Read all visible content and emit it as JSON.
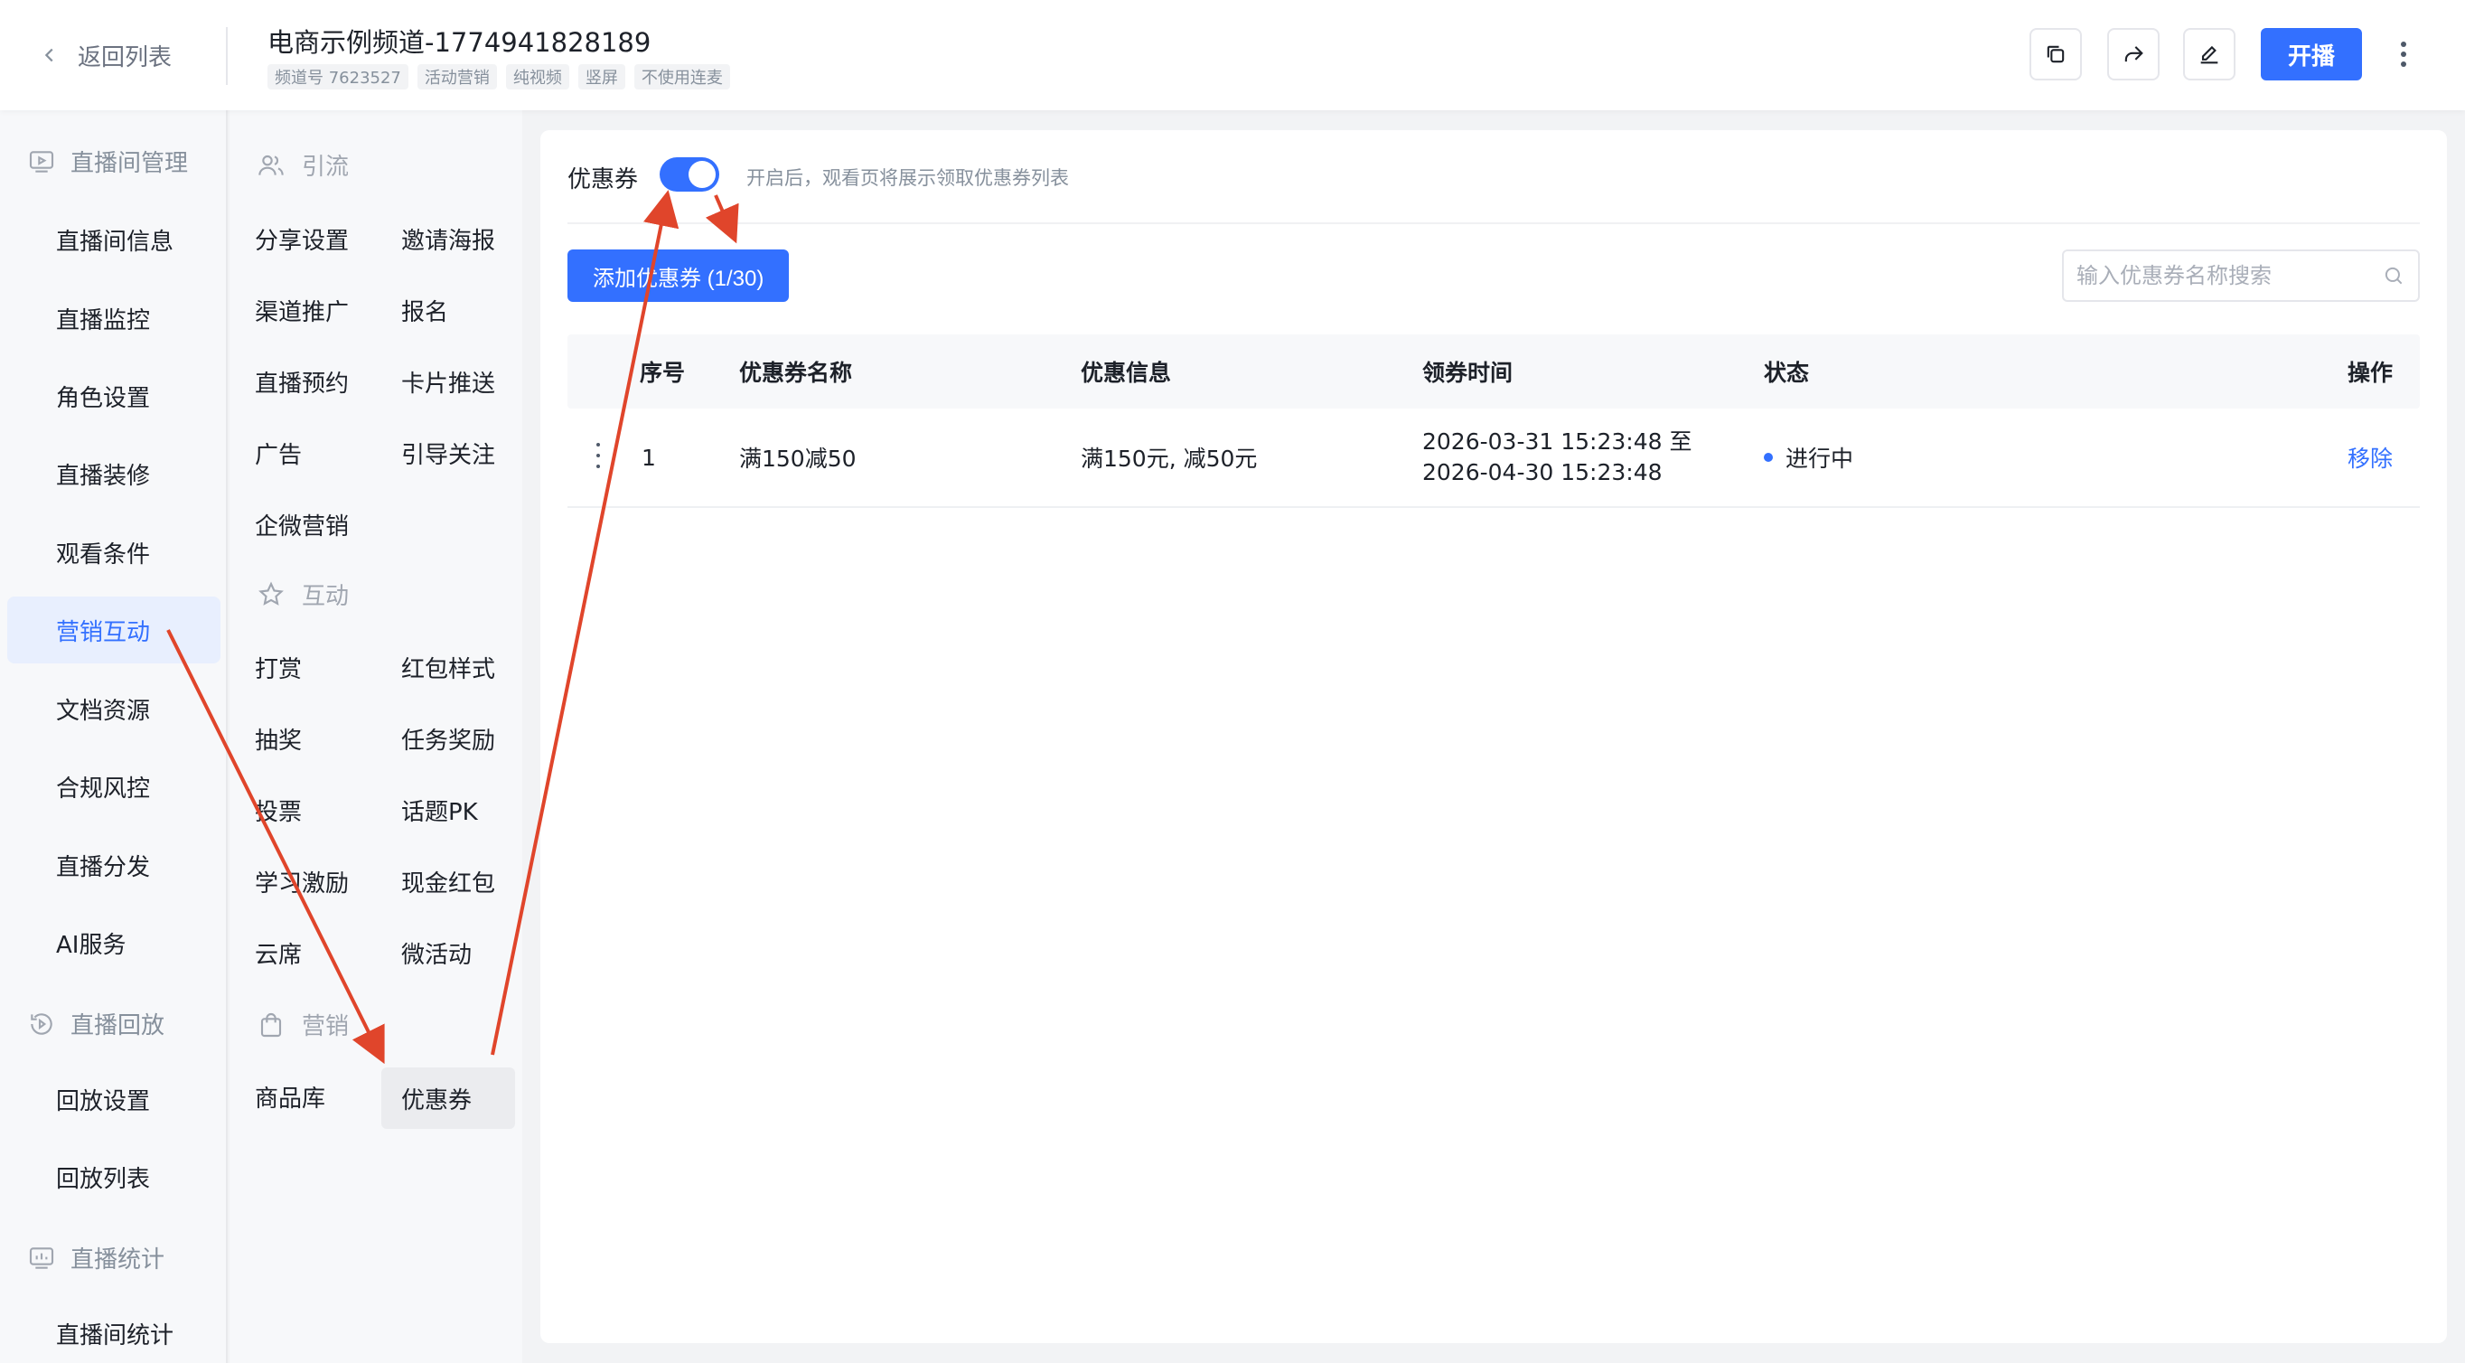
{
  "header": {
    "back_label": "返回列表",
    "title": "电商示例频道-1774941828189",
    "tags": [
      "频道号 7623527",
      "活动营销",
      "纯视频",
      "竖屏",
      "不使用连麦"
    ],
    "start_label": "开播"
  },
  "leftnav": {
    "groups": [
      {
        "label": "直播间管理",
        "icon": "live-room-icon"
      },
      {
        "label": "直播回放",
        "icon": "replay-icon"
      },
      {
        "label": "直播统计",
        "icon": "stats-icon"
      }
    ],
    "items": [
      "直播间信息",
      "直播监控",
      "角色设置",
      "直播装修",
      "观看条件",
      "营销互动",
      "文档资源",
      "合规风控",
      "直播分发",
      "AI服务",
      "回放设置",
      "回放列表",
      "直播间统计"
    ],
    "active": "营销互动"
  },
  "submenu": {
    "groups": [
      {
        "label": "引流",
        "icon": "users-icon"
      },
      {
        "label": "互动",
        "icon": "star-icon"
      },
      {
        "label": "营销",
        "icon": "bag-icon"
      }
    ],
    "items": [
      "分享设置",
      "邀请海报",
      "渠道推广",
      "报名",
      "直播预约",
      "卡片推送",
      "广告",
      "引导关注",
      "企微营销",
      "打赏",
      "红包样式",
      "抽奖",
      "任务奖励",
      "投票",
      "话题PK",
      "学习激励",
      "现金红包",
      "云席",
      "微活动",
      "商品库",
      "优惠券"
    ],
    "active": "优惠券"
  },
  "main": {
    "coupon_label": "优惠券",
    "switch_on": true,
    "switch_hint": "开启后，观看页将展示领取优惠券列表",
    "add_button": "添加优惠券 (1/30)",
    "search_placeholder": "输入优惠券名称搜索",
    "table": {
      "columns": [
        "序号",
        "优惠券名称",
        "优惠信息",
        "领券时间",
        "状态",
        "操作"
      ],
      "rows": [
        {
          "index": "1",
          "name": "满150减50",
          "info": "满150元, 减50元",
          "time_start": "2026-03-31 15:23:48 至",
          "time_end": "2026-04-30 15:23:48",
          "status": "进行中",
          "action": "移除"
        }
      ]
    }
  },
  "colors": {
    "accent": "#3370ff",
    "annotation": "#e0452b"
  }
}
